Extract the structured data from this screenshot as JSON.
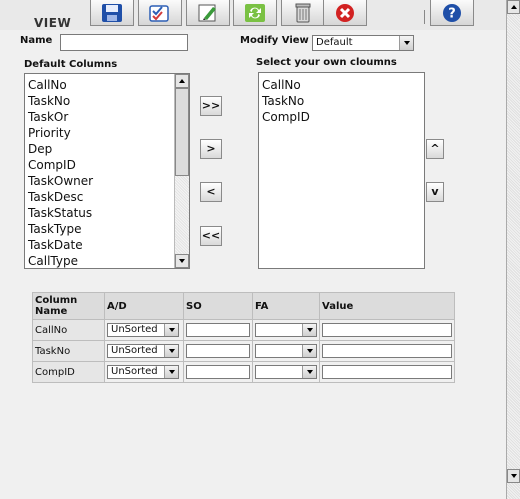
{
  "header": {
    "title": "VIEW"
  },
  "toolbar": {
    "buttons": [
      {
        "icon": "save-icon"
      },
      {
        "icon": "checklist-icon"
      },
      {
        "icon": "edit-icon"
      },
      {
        "icon": "refresh-icon"
      },
      {
        "icon": "trash-icon"
      },
      {
        "icon": "close-icon"
      },
      {
        "icon": "help-icon"
      }
    ],
    "help_label": "?"
  },
  "form": {
    "name_label": "Name",
    "name_value": "",
    "modify_view_label": "Modify View",
    "modify_view_value": "Default"
  },
  "default_columns": {
    "label": "Default Columns",
    "items": [
      "CallNo",
      "TaskNo",
      "TaskOr",
      "Priority",
      "Dep",
      "CompID",
      "TaskOwner",
      "TaskDesc",
      "TaskStatus",
      "TaskType",
      "TaskDate",
      "CallType"
    ]
  },
  "selected_columns": {
    "label": "Select your own cloumns",
    "items": [
      "CallNo",
      "TaskNo",
      "CompID"
    ]
  },
  "transfer_buttons": {
    "add_all": ">>",
    "add": ">",
    "remove": "<",
    "remove_all": "<<"
  },
  "order_buttons": {
    "up": "^",
    "down": "v"
  },
  "grid": {
    "headers": [
      "Column Name",
      "A/D",
      "SO",
      "FA",
      "Value"
    ],
    "rows": [
      {
        "name": "CallNo",
        "ad": "UnSorted",
        "so": "",
        "fa": "",
        "value": ""
      },
      {
        "name": "TaskNo",
        "ad": "UnSorted",
        "so": "",
        "fa": "",
        "value": ""
      },
      {
        "name": "CompID",
        "ad": "UnSorted",
        "so": "",
        "fa": "",
        "value": ""
      }
    ]
  },
  "colors": {
    "save": "#1f4fa8",
    "refresh": "#2a9d2a",
    "close": "#d22222",
    "help": "#1f4fa8"
  }
}
